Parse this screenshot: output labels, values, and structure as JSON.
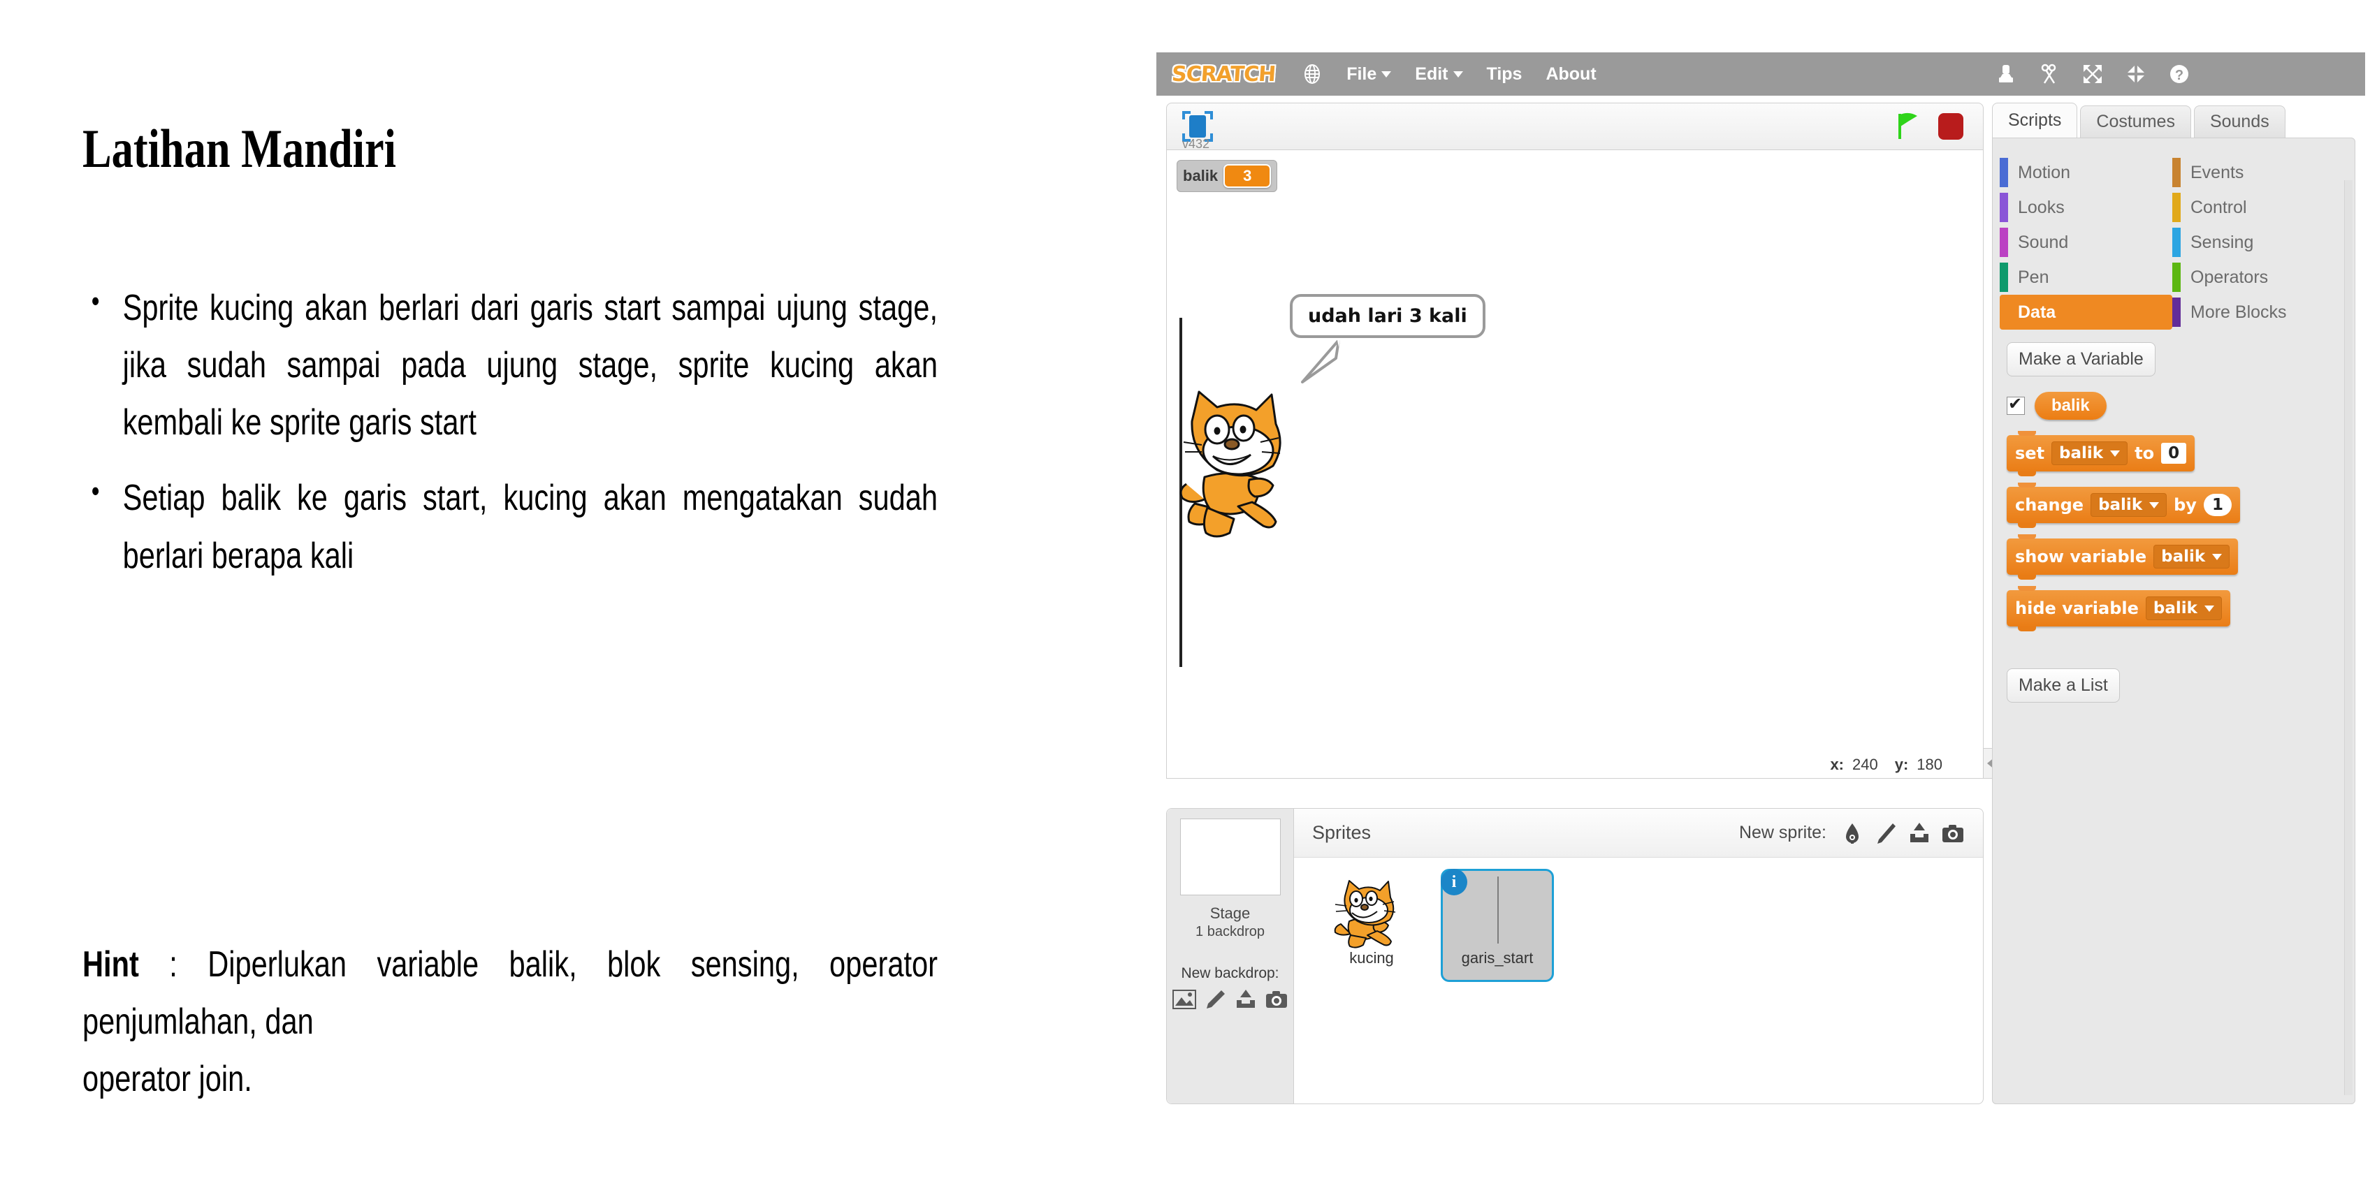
{
  "slide": {
    "title": "Latihan Mandiri",
    "bullets": [
      "Sprite kucing akan berlari dari garis start sampai ujung stage, jika sudah sampai pada ujung stage, sprite kucing akan kembali ke sprite garis start",
      "Setiap balik ke garis start, kucing akan mengatakan sudah berlari berapa kali"
    ],
    "hint_label": "Hint",
    "hint_separator": " : ",
    "hint_body": "Diperlukan variable balik, blok sensing, operator penjumlahan, dan",
    "hint_tail": "operator join."
  },
  "scratch": {
    "menubar": {
      "logo": "SCRATCH",
      "globe_icon": "globe-icon",
      "items": [
        {
          "label": "File",
          "has_caret": true
        },
        {
          "label": "Edit",
          "has_caret": true
        },
        {
          "label": "Tips",
          "has_caret": false
        },
        {
          "label": "About",
          "has_caret": false
        }
      ],
      "tools": [
        "stamp-icon",
        "scissors-icon",
        "grow-icon",
        "shrink-icon",
        "help-icon"
      ]
    },
    "stage": {
      "presentation_icon": "presentation-mode-icon",
      "version": "v432",
      "green_flag_icon": "green-flag-icon",
      "stop_icon": "stop-sign-icon",
      "watcher": {
        "name": "balik",
        "value": "3"
      },
      "speech_bubble": "udah lari 3 kali",
      "cat_sprite": "scratch-cat-sprite",
      "start_line": "garis-start-line",
      "coords": {
        "x_key": "x:",
        "x_val": "240",
        "y_key": "y:",
        "y_val": "180"
      }
    },
    "sprite_pane": {
      "stage_name": "Stage",
      "stage_sub": "1 backdrop",
      "new_backdrop_label": "New backdrop:",
      "backdrop_icons": [
        "library-icon",
        "paint-icon",
        "upload-icon",
        "camera-icon"
      ],
      "sprites_title": "Sprites",
      "new_sprite_label": "New sprite:",
      "new_sprite_icons": [
        "library-icon",
        "paint-icon",
        "upload-icon",
        "camera-icon"
      ],
      "sprites": [
        {
          "name": "kucing",
          "selected": false,
          "thumb": "cat-thumb"
        },
        {
          "name": "garis_start",
          "selected": true,
          "thumb": "line-thumb",
          "info_badge": "i"
        }
      ]
    },
    "right_panel": {
      "tabs": [
        {
          "label": "Scripts",
          "active": true
        },
        {
          "label": "Costumes",
          "active": false
        },
        {
          "label": "Sounds",
          "active": false
        }
      ],
      "categories_left": [
        {
          "label": "Motion",
          "color": "#4a6cd4",
          "active": false
        },
        {
          "label": "Looks",
          "color": "#8a55d7",
          "active": false
        },
        {
          "label": "Sound",
          "color": "#bb42c3",
          "active": false
        },
        {
          "label": "Pen",
          "color": "#0e9a6c",
          "active": false
        },
        {
          "label": "Data",
          "color": "#ee7d16",
          "active": true
        }
      ],
      "categories_right": [
        {
          "label": "Events",
          "color": "#c88330",
          "active": false
        },
        {
          "label": "Control",
          "color": "#e1a91a",
          "active": false
        },
        {
          "label": "Sensing",
          "color": "#2ca5e2",
          "active": false
        },
        {
          "label": "Operators",
          "color": "#5cb712",
          "active": false
        },
        {
          "label": "More Blocks",
          "color": "#632d99",
          "active": false
        }
      ],
      "make_variable_button": "Make a Variable",
      "variable": {
        "name": "balik",
        "checked": true
      },
      "blocks": [
        {
          "id": "set-block",
          "parts": [
            {
              "type": "text",
              "value": "set"
            },
            {
              "type": "dropdown",
              "value": "balik"
            },
            {
              "type": "text",
              "value": "to"
            },
            {
              "type": "square-input",
              "value": "0"
            }
          ]
        },
        {
          "id": "change-block",
          "parts": [
            {
              "type": "text",
              "value": "change"
            },
            {
              "type": "dropdown",
              "value": "balik"
            },
            {
              "type": "text",
              "value": "by"
            },
            {
              "type": "round-input",
              "value": "1"
            }
          ]
        },
        {
          "id": "show-variable-block",
          "parts": [
            {
              "type": "text",
              "value": "show variable"
            },
            {
              "type": "dropdown",
              "value": "balik"
            }
          ]
        },
        {
          "id": "hide-variable-block",
          "parts": [
            {
              "type": "text",
              "value": "hide variable"
            },
            {
              "type": "dropdown",
              "value": "balik"
            }
          ]
        }
      ],
      "make_list_button": "Make a List"
    }
  }
}
